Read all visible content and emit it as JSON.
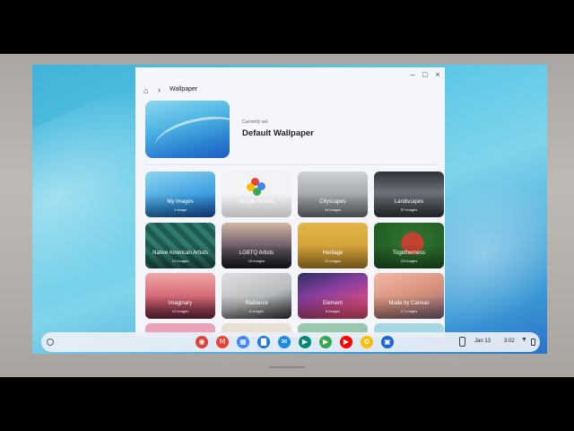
{
  "window": {
    "controls": {
      "minimize": "–",
      "maximize": "□",
      "close": "×"
    },
    "breadcrumb": {
      "separator": "›",
      "title": "Wallpaper"
    }
  },
  "current": {
    "caption": "Currently set",
    "name": "Default Wallpaper"
  },
  "collections": [
    {
      "label": "My Images",
      "count": "1 image"
    },
    {
      "label": "Google Photos",
      "count": ""
    },
    {
      "label": "Cityscapes",
      "count": "44 images"
    },
    {
      "label": "Landscapes",
      "count": "57 images"
    },
    {
      "label": "Native American Artists",
      "count": "12 images"
    },
    {
      "label": "LGBTQ Artists",
      "count": "15 images"
    },
    {
      "label": "Heritage",
      "count": "20 images"
    },
    {
      "label": "Togetherness",
      "count": "24 images"
    },
    {
      "label": "Imaginary",
      "count": "12 images"
    },
    {
      "label": "Radiance",
      "count": "6 images"
    },
    {
      "label": "Element",
      "count": "8 images"
    },
    {
      "label": "Made by Canvas",
      "count": "17 images"
    }
  ],
  "shelf": {
    "apps": [
      {
        "icon": "chrome-icon",
        "color": "#db4437",
        "glyph": "◉"
      },
      {
        "icon": "gmail-icon",
        "color": "#ea4335",
        "glyph": "M"
      },
      {
        "icon": "calendar-icon",
        "color": "#4285f4",
        "glyph": "▦"
      },
      {
        "icon": "files-icon",
        "color": "#1a73e8",
        "glyph": "▇"
      },
      {
        "icon": "messages-icon",
        "color": "#1e88e5",
        "glyph": "✉"
      },
      {
        "icon": "meet-icon",
        "color": "#00897b",
        "glyph": "▶"
      },
      {
        "icon": "play-store-icon",
        "color": "#34a853",
        "glyph": "▶"
      },
      {
        "icon": "youtube-icon",
        "color": "#ff0000",
        "glyph": "▶"
      },
      {
        "icon": "photos-icon",
        "color": "#fbbc04",
        "glyph": "✿"
      },
      {
        "icon": "wallpaper-icon",
        "color": "#1967d2",
        "glyph": "▣"
      }
    ],
    "date": "Jan 13",
    "time": "3:02"
  }
}
